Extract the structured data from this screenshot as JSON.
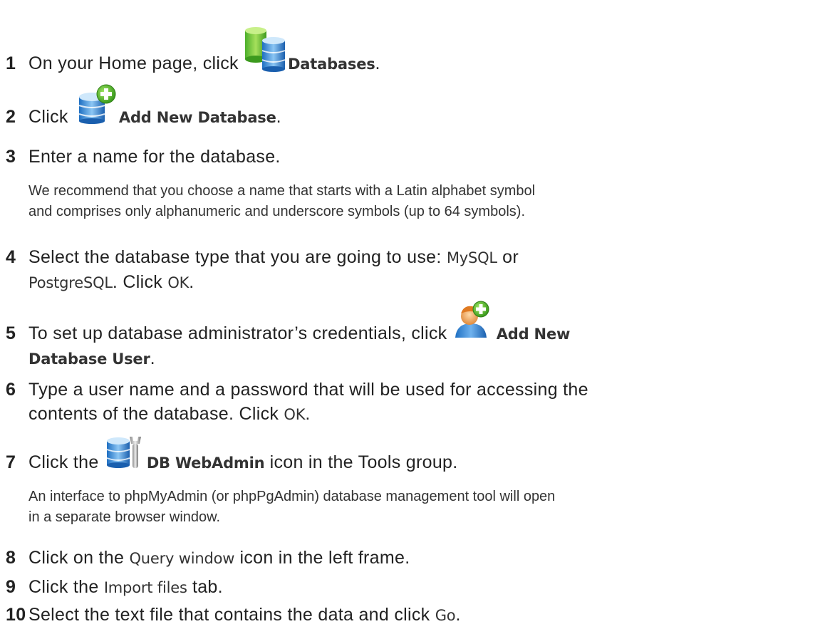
{
  "steps": [
    {
      "num": "1",
      "pre": "On your Home page, click ",
      "ui": "Databases",
      "post": "."
    },
    {
      "num": "2",
      "pre": "Click ",
      "ui": "Add New Database",
      "post": "."
    },
    {
      "num": "3",
      "text": "Enter a name for the database."
    },
    {
      "num": "4",
      "pre": "Select the database type that you are going to use: ",
      "ui1": "MySQL",
      "mid": " or",
      "ui2": "PostgreSQL",
      "mid2": ". Click ",
      "ui3": "OK",
      "post": "."
    },
    {
      "num": "5",
      "pre": "To set up database administrator’s credentials, click ",
      "ui1": "Add New",
      "ui2": "Database User",
      "post": "."
    },
    {
      "num": "6",
      "text": "Type a user name and a password that will be used for accessing the",
      "text2": "contents of the database. Click ",
      "ui": "OK",
      "post": "."
    },
    {
      "num": "7",
      "pre": "Click the ",
      "ui": "DB WebAdmin",
      "post": " icon in the Tools group."
    },
    {
      "num": "8",
      "pre": "Click on the ",
      "ui": "Query window",
      "post": " icon in the left frame."
    },
    {
      "num": "9",
      "pre": "Click the ",
      "ui": "Import files",
      "post": " tab."
    },
    {
      "num": "10",
      "pre": "Select the text file that contains the data and click ",
      "ui": "Go",
      "post": "."
    }
  ],
  "notes": {
    "step3": [
      "We recommend that you choose a name that starts with a Latin alphabet symbol",
      "and comprises only alphanumeric and underscore symbols (up to 64 symbols)."
    ],
    "step7": [
      "An interface to phpMyAdmin (or phpPgAdmin) database management tool will open",
      "in a separate browser window."
    ]
  },
  "icons": {
    "databases": "databases-icon",
    "add_database": "add-database-icon",
    "add_user": "add-user-icon",
    "db_webadmin": "db-webadmin-icon"
  }
}
